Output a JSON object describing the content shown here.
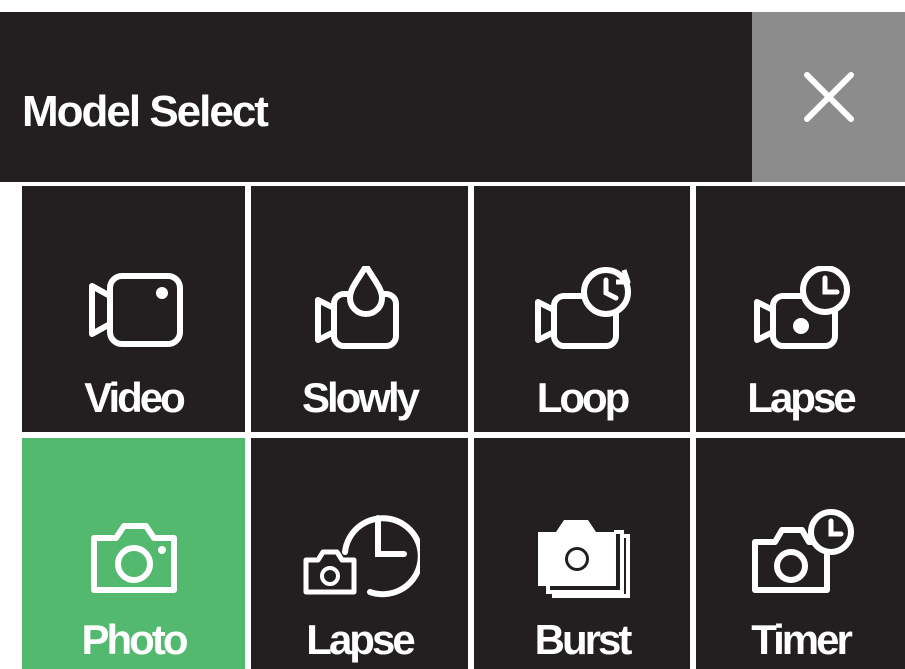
{
  "header": {
    "title": "Model Select",
    "close_icon": "close-icon"
  },
  "modes": [
    {
      "label": "Video",
      "icon": "video-camera-icon",
      "selected": false
    },
    {
      "label": "Slowly",
      "icon": "slow-motion-icon",
      "selected": false
    },
    {
      "label": "Loop",
      "icon": "loop-recording-icon",
      "selected": false
    },
    {
      "label": "Lapse",
      "icon": "video-timelapse-icon",
      "selected": false
    },
    {
      "label": "Photo",
      "icon": "photo-camera-icon",
      "selected": true
    },
    {
      "label": "Lapse",
      "icon": "photo-timelapse-icon",
      "selected": false
    },
    {
      "label": "Burst",
      "icon": "burst-photo-icon",
      "selected": false
    },
    {
      "label": "Timer",
      "icon": "self-timer-icon",
      "selected": false
    }
  ],
  "colors": {
    "background": "#231f20",
    "selected": "#52b96f",
    "close_button": "#8c8c8c",
    "foreground": "#ffffff"
  }
}
